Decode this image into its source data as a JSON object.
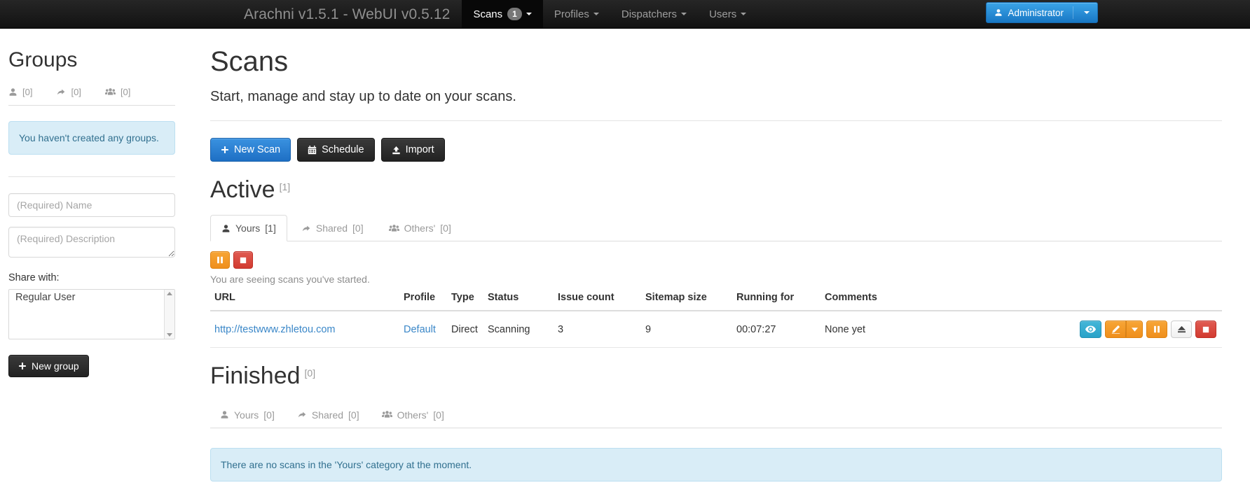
{
  "navbar": {
    "brand": "Arachni v1.5.1 - WebUI v0.5.12",
    "items": [
      {
        "label": "Scans",
        "badge": "1",
        "active": true
      },
      {
        "label": "Profiles",
        "badge": "",
        "active": false
      },
      {
        "label": "Dispatchers",
        "badge": "",
        "active": false
      },
      {
        "label": "Users",
        "badge": "",
        "active": false
      }
    ],
    "user_button": {
      "label": "Administrator",
      "icon": "user-icon",
      "color": "#2a8fd8"
    }
  },
  "sidebar": {
    "title": "Groups",
    "tabs": [
      {
        "icon": "user-icon",
        "count": "[0]"
      },
      {
        "icon": "share-arrow-icon",
        "count": "[0]"
      },
      {
        "icon": "users-group-icon",
        "count": "[0]"
      }
    ],
    "alert": "You haven't created any groups.",
    "name_placeholder": "(Required) Name",
    "description_placeholder": "(Required) Description",
    "share_label": "Share with:",
    "share_options": [
      "Regular User"
    ],
    "new_group_button": "New group"
  },
  "main": {
    "title": "Scans",
    "lead": "Start, manage and stay up to date on your scans.",
    "buttons": [
      {
        "label": "New Scan",
        "icon": "plus-icon",
        "style": "primary"
      },
      {
        "label": "Schedule",
        "icon": "calendar-icon",
        "style": "black"
      },
      {
        "label": "Import",
        "icon": "upload-icon",
        "style": "black"
      }
    ],
    "active": {
      "heading": "Active",
      "count": "[1]",
      "tabs": [
        {
          "label": "Yours",
          "count": "[1]",
          "icon": "user-icon",
          "active": true
        },
        {
          "label": "Shared",
          "count": "[0]",
          "icon": "share-arrow-icon",
          "active": false
        },
        {
          "label": "Others'",
          "count": "[0]",
          "icon": "users-group-icon",
          "active": false
        }
      ],
      "bulk_buttons": [
        {
          "icon": "pause-icon",
          "style": "orange"
        },
        {
          "icon": "stop-icon",
          "style": "red"
        }
      ],
      "note": "You are seeing scans you've started.",
      "columns": [
        "URL",
        "Profile",
        "Type",
        "Status",
        "Issue count",
        "Sitemap size",
        "Running for",
        "Comments"
      ],
      "rows": [
        {
          "url": "http://testwww.zhletou.com",
          "profile": "Default",
          "type": "Direct",
          "status": "Scanning",
          "issue_count": "3",
          "sitemap_size": "9",
          "running_for": "00:07:27",
          "comments": "None yet",
          "actions": [
            {
              "icon": "eye-icon",
              "style": "info"
            },
            {
              "icon": "pencil-icon",
              "style": "warn"
            },
            {
              "icon": "caret-down-icon",
              "style": "warn"
            },
            {
              "icon": "pause-icon",
              "style": "warn"
            },
            {
              "icon": "eject-icon",
              "style": "default"
            },
            {
              "icon": "stop-icon",
              "style": "danger"
            }
          ]
        }
      ]
    },
    "finished": {
      "heading": "Finished",
      "count": "[0]",
      "tabs": [
        {
          "label": "Yours",
          "count": "[0]",
          "icon": "user-icon",
          "active": false
        },
        {
          "label": "Shared",
          "count": "[0]",
          "icon": "share-arrow-icon",
          "active": false
        },
        {
          "label": "Others'",
          "count": "[0]",
          "icon": "users-group-icon",
          "active": false
        }
      ],
      "alert": "There are no scans in the 'Yours' category at the moment."
    }
  }
}
